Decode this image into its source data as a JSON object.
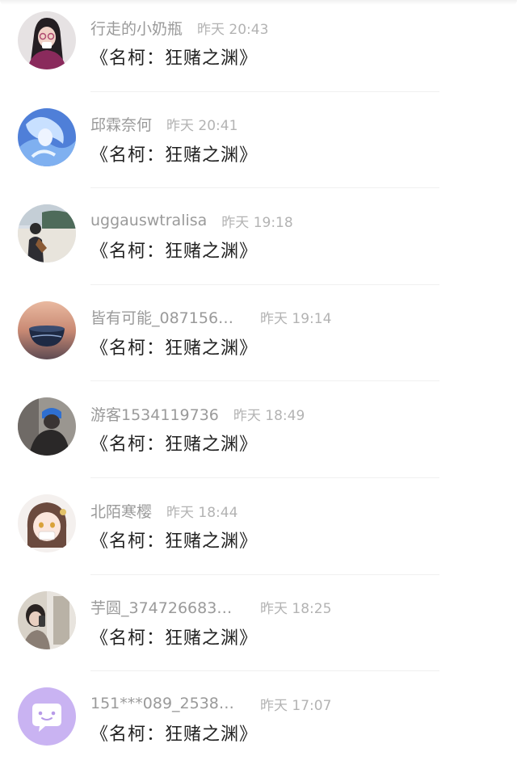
{
  "comments": [
    {
      "username": "行走的小奶瓶",
      "time": "昨天 20:43",
      "text": "《名柯：狂赌之渊》",
      "avatar": "woman-dark-hair-photo"
    },
    {
      "username": "邱霖奈何",
      "time": "昨天 20:41",
      "text": "《名柯：狂赌之渊》",
      "avatar": "blue-illustration-photo"
    },
    {
      "username": "uggauswtralisa",
      "time": "昨天 19:18",
      "text": "《名柯：狂赌之渊》",
      "avatar": "beach-person-photo"
    },
    {
      "username": "皆有可能_087156…",
      "time": "昨天 19:14",
      "text": "《名柯：狂赌之渊》",
      "avatar": "sunset-glass-photo"
    },
    {
      "username": "游客1534119736",
      "time": "昨天 18:49",
      "text": "《名柯：狂赌之渊》",
      "avatar": "man-blue-cap-photo"
    },
    {
      "username": "北陌寒樱",
      "time": "昨天 18:44",
      "text": "《名柯：狂赌之渊》",
      "avatar": "anime-girl-avatar"
    },
    {
      "username": "芋圆_374726683…",
      "time": "昨天 18:25",
      "text": "《名柯：狂赌之渊》",
      "avatar": "mirror-selfie-photo"
    },
    {
      "username": "151***089_2538…",
      "time": "昨天 17:07",
      "text": "《名柯：狂赌之渊》",
      "avatar": "default-chat-bubble-icon"
    }
  ],
  "colors": {
    "username": "#9a9a9a",
    "time": "#b3b3b3",
    "content": "#222222",
    "default_avatar_bg": "#c9b3f2"
  }
}
